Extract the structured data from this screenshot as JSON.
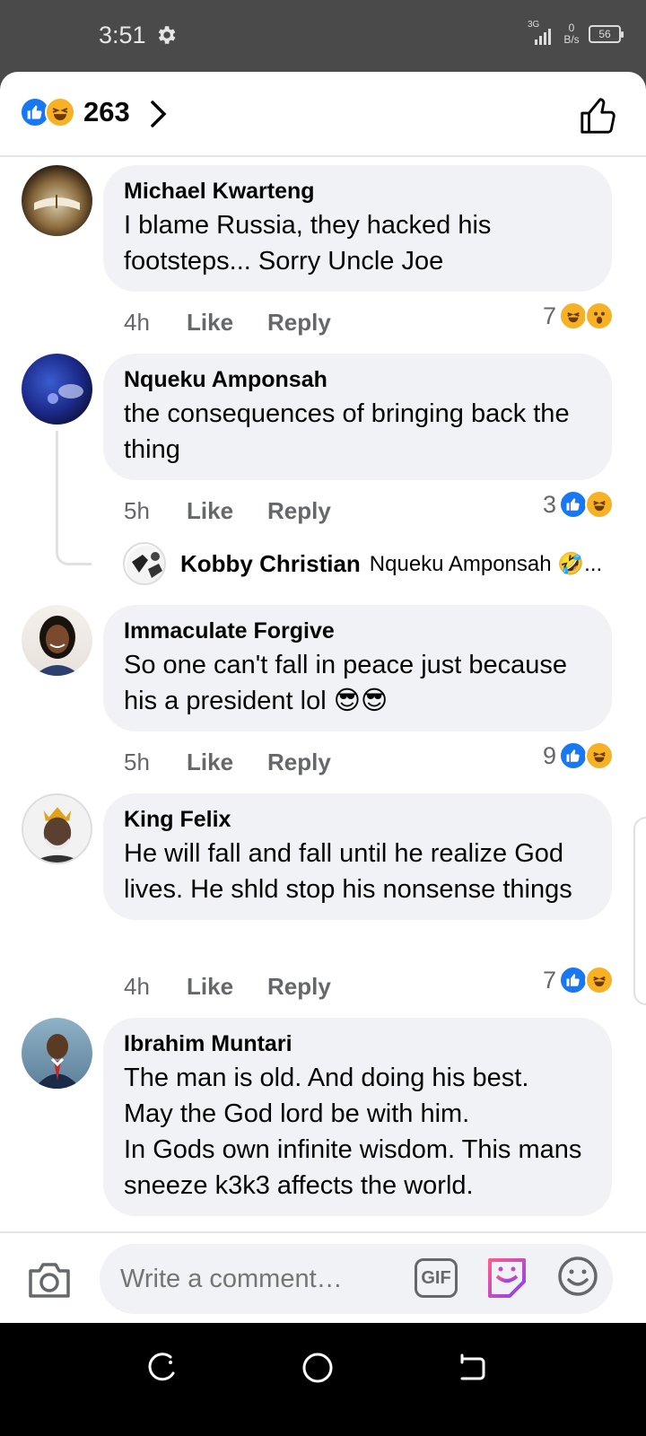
{
  "status": {
    "time": "3:51",
    "network": "3G",
    "speed_value": "0",
    "speed_unit": "B/s",
    "battery": "56"
  },
  "header": {
    "reaction_count": "263"
  },
  "comments": [
    {
      "author": "Michael Kwarteng",
      "text": "I blame Russia, they hacked his footsteps... Sorry Uncle Joe",
      "time": "4h",
      "like": "Like",
      "reply": "Reply",
      "reactions": "7"
    },
    {
      "author": "Nqueku Amponsah",
      "text": "the consequences of bringing back the thing",
      "time": "5h",
      "like": "Like",
      "reply": "Reply",
      "reactions": "3"
    },
    {
      "author": "Immaculate Forgive",
      "text": "So one can't fall in peace just because his a president lol 😎😎",
      "time": "5h",
      "like": "Like",
      "reply": "Reply",
      "reactions": "9"
    },
    {
      "author": "King Felix",
      "text": "He will fall and fall until he realize God lives. He shld stop his nonsense things",
      "time": "4h",
      "like": "Like",
      "reply": "Reply",
      "reactions": "7"
    },
    {
      "author": "Ibrahim Muntari",
      "text": "The man is old. And doing his best.\nMay the God lord be with him.\nIn Gods own infinite wisdom. This mans sneeze k3k3 affects the world."
    }
  ],
  "reply_preview": {
    "author": "Kobby Christian",
    "text": "Nqueku Amponsah 🤣..."
  },
  "composer": {
    "placeholder": "Write a comment…",
    "gif_label": "GIF"
  },
  "colors": {
    "like_blue": "#1877f2",
    "haha_yellow": "#f7b125",
    "bubble_gray": "#f0f2f5",
    "meta_gray": "#65676b"
  }
}
